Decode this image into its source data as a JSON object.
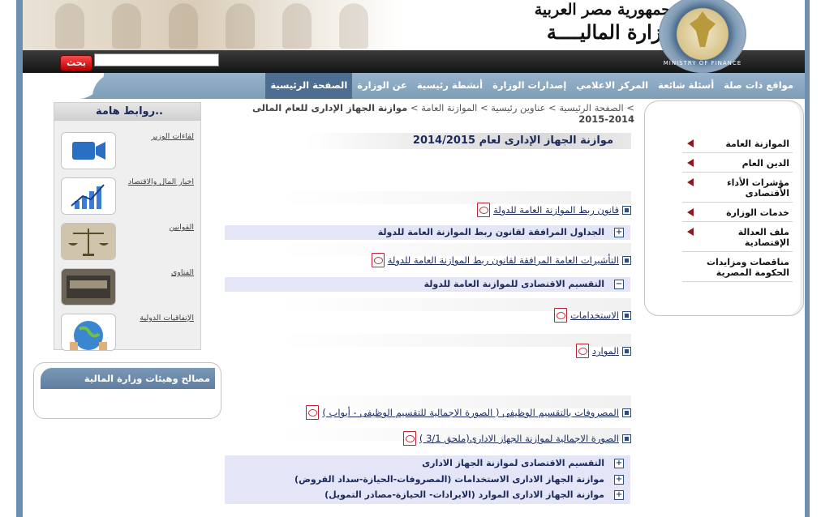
{
  "header": {
    "republic": "جمهورية مصر العربية",
    "ministry": "وزارة الماليــــة",
    "seal_text": "MINISTRY OF FINANCE"
  },
  "search": {
    "button_label": "بحث",
    "value": ""
  },
  "nav": {
    "items": [
      "الصفحة الرئيسية",
      "عن الوزارة",
      "أنشطة رئيسية",
      "إصدارات الوزارة",
      "المركز الاعلامي",
      "أسئلة شائعة",
      "مواقع ذات صلة"
    ]
  },
  "right_menu": {
    "items": [
      "الموازنة العامة",
      "الدين العام",
      "مؤشرات الأداء الأقتصادى",
      "خدمات الوزارة",
      "ملف العدالة الإقتصادية",
      "مناقصات ومزايدات الحكومة المصرية"
    ]
  },
  "links": {
    "title": "..روابط هامة",
    "items": [
      "لقاءات الوزير",
      "اخبار المال والاقتصاد",
      "القوانين",
      "الفتاوى",
      "الإتفاقيات الدولية"
    ]
  },
  "agencies": {
    "title": "مصالح وهيئات وزارة المالية"
  },
  "breadcrumb": {
    "sep": " > ",
    "home": "الصفحة الرئيسية",
    "headlines": "عناوين رئيسية",
    "budget": "الموازنة العامة",
    "current": "موازنة الجهاز الإدارى للعام المالى 2014-2015"
  },
  "content": {
    "heading": "موازنة الجهاز الإدارى لعام 2014/2015",
    "docs": [
      "قانون ربط الموازنة العامة للدولة",
      "التأشيرات العامة المرافقة لقانون ربط الموازنة العامة للدولة",
      "الاستخدامات",
      "الموارد",
      "المصروفات بالتقسيم الوظيفى ( الصورة الاجمالية للتقسيم الوظيفى - أبواب )",
      "الصورة الاجمالية لموازنة الجهاز الادارى(ملحق 3/1 )"
    ],
    "sections": [
      {
        "label": "الجداول المرافقة لقانون ربط الموازنة العامة للدولة",
        "state": "+"
      },
      {
        "label": "التقسيم الاقتصادى للموازنة العامة للدولة",
        "state": "−"
      },
      {
        "label": "التقسيم الاقتصادى لموازنة الجهاز الادارى",
        "state": "+"
      },
      {
        "label": "موازنة الجهاز الادارى الاستخدامات (المصروفات-الحيازة-سداد القروض)",
        "state": "+"
      },
      {
        "label": "موازنة الجهاز الادارى الموارد (الايرادات- الحيازة-مصادر التمويل)",
        "state": "+"
      }
    ]
  }
}
